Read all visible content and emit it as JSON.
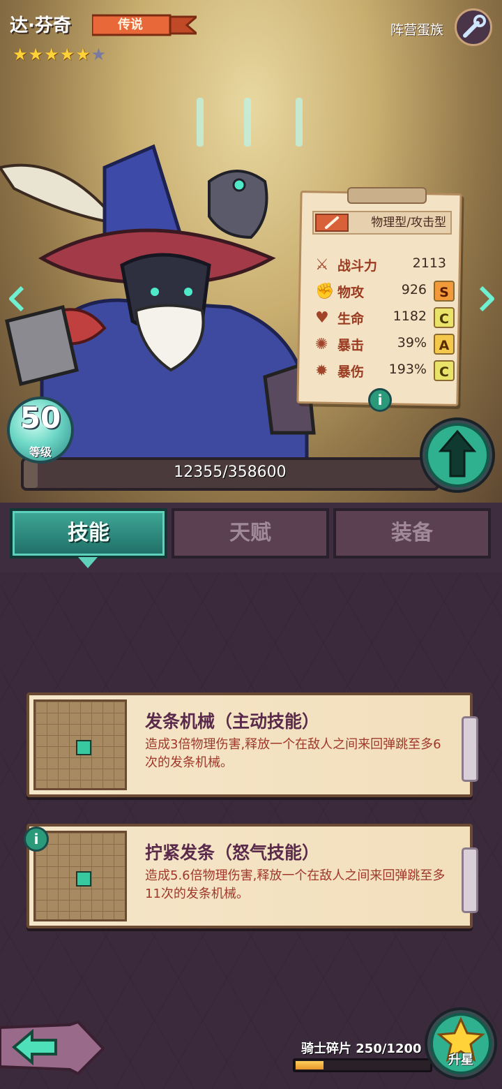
{
  "hero": {
    "name": "达·芬奇",
    "rarity": "传说",
    "stars_filled": 5,
    "stars_total": 6,
    "faction": "阵营蛋族"
  },
  "stats": {
    "type": "物理型/攻击型",
    "rows": [
      {
        "icon": "combat-power-icon",
        "label": "战斗力",
        "value": "2113",
        "grade": ""
      },
      {
        "icon": "attack-fist-icon",
        "label": "物攻",
        "value": "926",
        "grade": "S"
      },
      {
        "icon": "heart-icon",
        "label": "生命",
        "value": "1182",
        "grade": "C"
      },
      {
        "icon": "crit-icon",
        "label": "暴击",
        "value": "39%",
        "grade": "A"
      },
      {
        "icon": "crit-damage-icon",
        "label": "暴伤",
        "value": "193%",
        "grade": "C"
      }
    ]
  },
  "level": {
    "number": "50",
    "label": "等级",
    "exp_text": "12355/358600",
    "exp_current": 12355,
    "exp_max": 358600
  },
  "tabs": [
    {
      "label": "技能",
      "active": true
    },
    {
      "label": "天赋",
      "active": false
    },
    {
      "label": "装备",
      "active": false
    }
  ],
  "skills": [
    {
      "title": "发条机械（主动技能）",
      "desc": "造成3倍物理伤害,释放一个在敌人之间来回弹跳至多6次的发条机械。"
    },
    {
      "title": "拧紧发条（怒气技能）",
      "desc": "造成5.6倍物理伤害,释放一个在敌人之间来回弹跳至多11次的发条机械。"
    }
  ],
  "shards": {
    "label": "骑士碎片 250/1200",
    "current": 250,
    "max": 1200
  },
  "star_up_label": "升星",
  "colors": {
    "teal_accent": "#3fa897",
    "grade_s": "#f29a3a",
    "grade_a": "#f4c84a",
    "grade_c": "#e9e36a",
    "shard_fill": "#e8962a"
  }
}
